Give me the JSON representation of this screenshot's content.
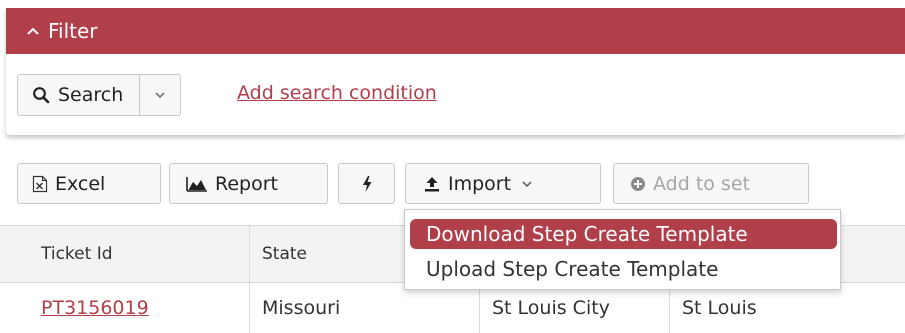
{
  "filter": {
    "title": "Filter",
    "search_label": "Search",
    "add_condition": "Add search condition"
  },
  "toolbar": {
    "excel": "Excel",
    "report": "Report",
    "import": "Import",
    "add_to_set": "Add to set"
  },
  "import_menu": {
    "items": [
      "Download Step Create Template",
      "Upload Step Create Template"
    ],
    "active_index": 0
  },
  "table": {
    "columns": [
      "Ticket Id",
      "State",
      "",
      ""
    ],
    "rows": [
      [
        "PT3156019",
        "Missouri",
        "St Louis City",
        "St Louis"
      ]
    ]
  },
  "colors": {
    "accent": "#b03f4a",
    "header_bg": "#f3f3f3",
    "button_bg": "#f7f7f7",
    "disabled_text": "#a6a6a6"
  },
  "icons": {
    "filter_toggle": "chevron-up-icon",
    "search": "search-icon",
    "search_options": "chevron-down-icon",
    "excel": "excel-file-icon",
    "report": "area-chart-icon",
    "quick_action": "lightning-bolt-icon",
    "import": "upload-icon",
    "add_to_set": "plus-circle-icon"
  }
}
